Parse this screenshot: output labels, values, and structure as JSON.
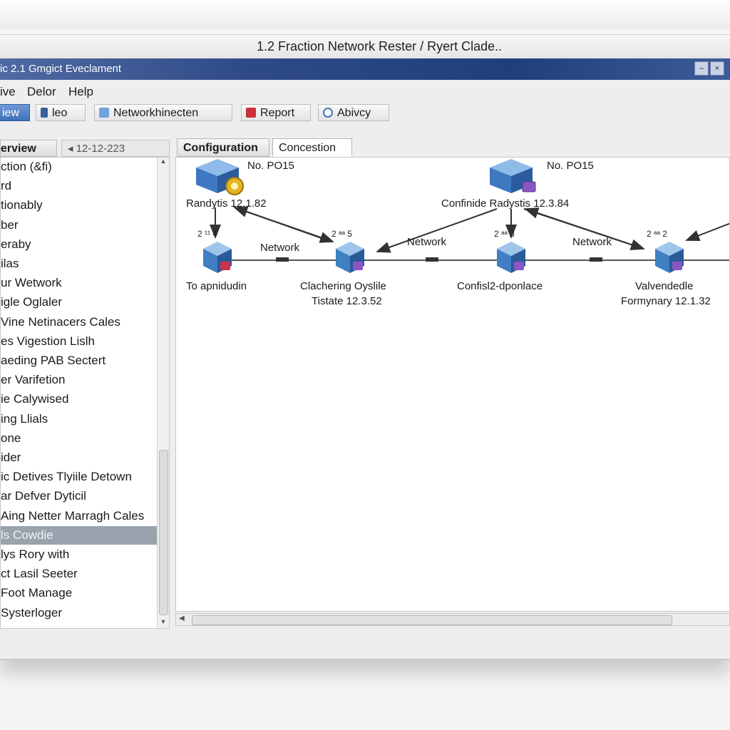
{
  "window": {
    "outer_title": "1.2 Fraction Network Rester / Ryert Clade..",
    "title": "ic 2.1 Gmgict Eveclament"
  },
  "menu": [
    "ive",
    "Delor",
    "Help"
  ],
  "toolbar": [
    {
      "label": "iew",
      "icon": "view-icon",
      "active": true
    },
    {
      "label": "leo",
      "icon": "user-icon",
      "active": false
    },
    {
      "label": "Networkhinecten",
      "icon": "network-icon",
      "active": false
    },
    {
      "label": "Report",
      "icon": "report-icon",
      "active": false
    },
    {
      "label": "Abivcy",
      "icon": "refresh-icon",
      "active": false
    }
  ],
  "left_panel": {
    "tab_label": "erview",
    "date_label": "12-12-223",
    "items": [
      "ction (&fi)",
      "rd",
      "tionably",
      "ber",
      "eraby",
      "ilas",
      "ur Wetwork",
      "igle Oglaler",
      "Vine Netinacers Cales",
      "es Vigestion Lislh",
      "aeding PAB Sectert",
      "er Varifetion",
      "ie Calywised",
      "ing Llials",
      "one",
      "ider",
      "ic Detives Tlyiile Detown",
      "ar Defver Dyticil",
      "Aing Netter Marragh Cales",
      "ls Cowdie",
      "lys Rory with",
      "ct Lasil Seeter",
      "Foot Manage",
      "Systerloger"
    ],
    "selected_index": 19
  },
  "tabs": [
    "Configuration",
    "Concestion"
  ],
  "diagram": {
    "top_nodes": [
      {
        "id": "n1",
        "header": "No. PO15",
        "label": "Randytis 12.1.82"
      },
      {
        "id": "n2",
        "header": "No. PO15",
        "label": "Confinide Radystis 12.3.84"
      }
    ],
    "bottom_nodes": [
      {
        "id": "b1",
        "small": "2 ¹¹ 4",
        "label1": "To apnidudin",
        "label2": ""
      },
      {
        "id": "b2",
        "small": "2 ᵃᵃ 5",
        "label1": "Clachering Oyslile",
        "label2": "Tistate 12.3.52"
      },
      {
        "id": "b3",
        "small": "2 ᵃᵃ 3",
        "label1": "Confisl2-dponlace",
        "label2": ""
      },
      {
        "id": "b4",
        "small": "2 ᵃᵃ 2",
        "label1": "Valvendedle",
        "label2": "Formynary 12.1.32"
      }
    ],
    "link_labels": [
      "Network",
      "Network",
      "Network"
    ]
  },
  "colors": {
    "titlebar": "#1f3f7c",
    "node_blue": "#5a8fd0",
    "badge_gold": "#e5b323",
    "badge_purple": "#8a56c4",
    "selection": "#9aa3ad"
  }
}
